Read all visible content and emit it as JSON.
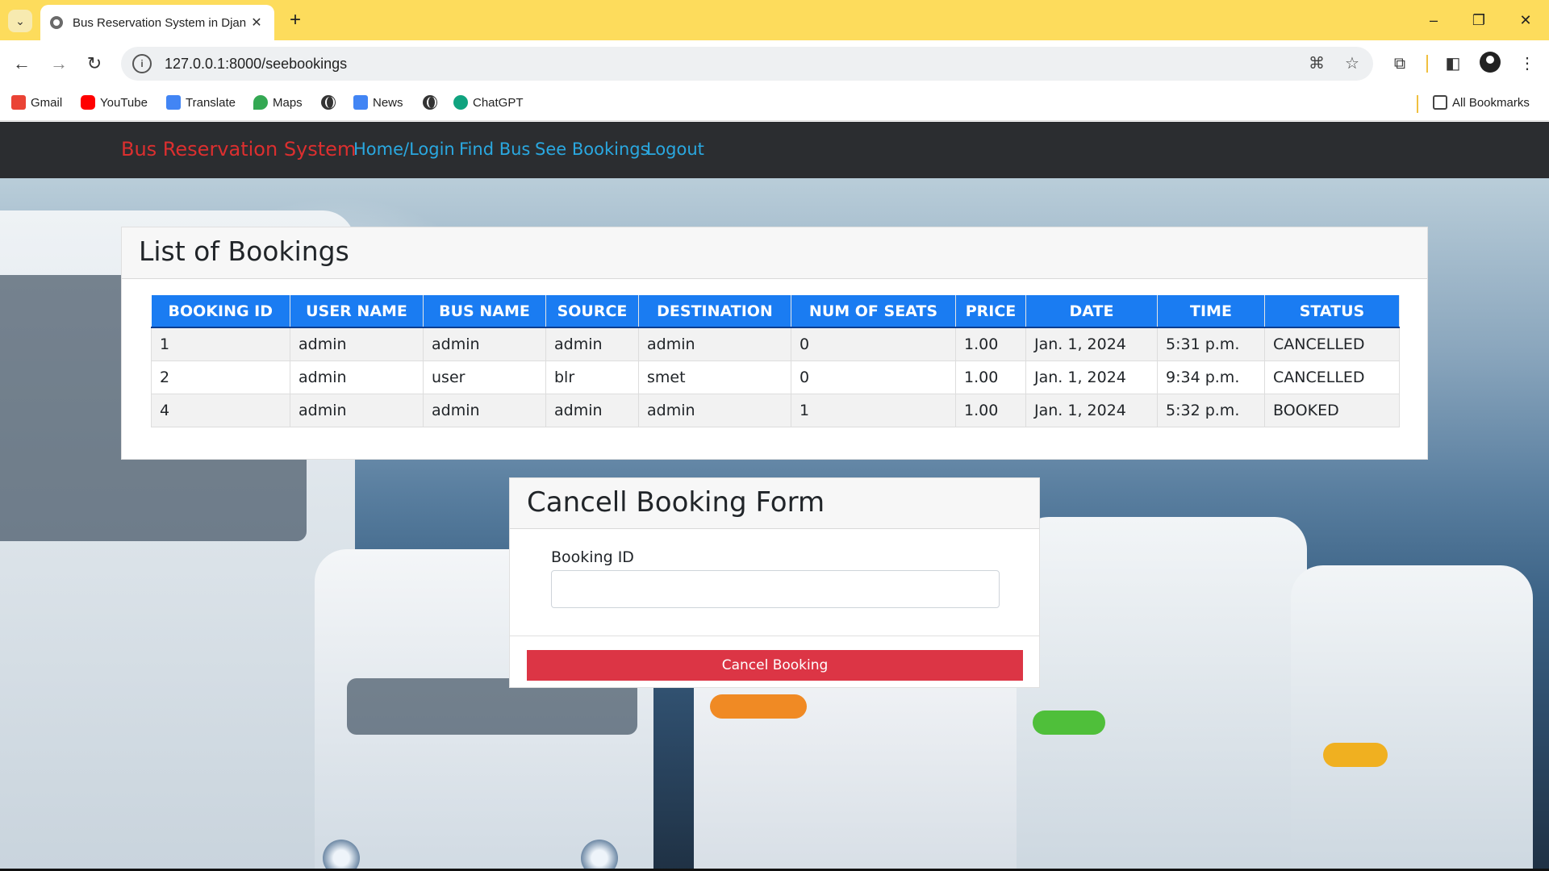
{
  "browser": {
    "tab_title": "Bus Reservation System in Djan",
    "url": "127.0.0.1:8000/seebookings",
    "bookmarks": [
      {
        "label": "Gmail",
        "icon": "gmail-icon",
        "color": "#ea4335"
      },
      {
        "label": "YouTube",
        "icon": "youtube-icon",
        "color": "#ff0000"
      },
      {
        "label": "Translate",
        "icon": "translate-icon",
        "color": "#4285f4"
      },
      {
        "label": "Maps",
        "icon": "maps-icon",
        "color": "#34a853"
      },
      {
        "label": "",
        "icon": "globe-icon",
        "color": "#333333"
      },
      {
        "label": "News",
        "icon": "news-icon",
        "color": "#4285f4"
      },
      {
        "label": "",
        "icon": "globe-icon",
        "color": "#333333"
      },
      {
        "label": "ChatGPT",
        "icon": "chatgpt-icon",
        "color": "#10a37f"
      }
    ],
    "all_bookmarks": "All Bookmarks"
  },
  "app": {
    "brand": "Bus Reservation System",
    "nav": [
      "Home/Login",
      "Find Bus",
      "See Bookings",
      "Logout"
    ],
    "colors": {
      "brand": "#dc2f2f",
      "link": "#2aa8e0",
      "navbar": "#2b2d30",
      "table_header": "#1a7cf2",
      "danger": "#dc3545"
    }
  },
  "bookings": {
    "title": "List of Bookings",
    "columns": [
      "BOOKING ID",
      "USER NAME",
      "BUS NAME",
      "SOURCE",
      "DESTINATION",
      "NUM OF SEATS",
      "PRICE",
      "DATE",
      "TIME",
      "STATUS"
    ],
    "rows": [
      [
        "1",
        "admin",
        "admin",
        "admin",
        "admin",
        "0",
        "1.00",
        "Jan. 1, 2024",
        "5:31 p.m.",
        "CANCELLED"
      ],
      [
        "2",
        "admin",
        "user",
        "blr",
        "smet",
        "0",
        "1.00",
        "Jan. 1, 2024",
        "9:34 p.m.",
        "CANCELLED"
      ],
      [
        "4",
        "admin",
        "admin",
        "admin",
        "admin",
        "1",
        "1.00",
        "Jan. 1, 2024",
        "5:32 p.m.",
        "BOOKED"
      ]
    ]
  },
  "cancel_form": {
    "title": "Cancell Booking Form",
    "label": "Booking ID",
    "value": "",
    "button": "Cancel Booking"
  }
}
